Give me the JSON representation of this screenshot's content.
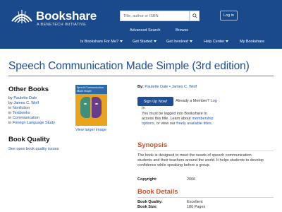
{
  "header": {
    "logo_name": "Bookshare",
    "logo_tagline": "A BENETECH INITIATIVE",
    "search_placeholder": "Title, author or ISBN",
    "login_label": "Log in",
    "sublinks": [
      "Advanced Search",
      "Browse"
    ],
    "nav": [
      {
        "label": "Is Bookshare For Me?",
        "has_caret": true
      },
      {
        "label": "Get Started",
        "has_caret": true
      },
      {
        "label": "Get Involved",
        "has_caret": true
      },
      {
        "label": "Help Center",
        "has_caret": true
      },
      {
        "label": "My Bookshare",
        "has_caret": false
      }
    ]
  },
  "book": {
    "title": "Speech Communication Made Simple (3rd edition)",
    "cover_title": "Speech Communication Made Simple",
    "view_larger": "View larger image",
    "by_label": "By:",
    "authors": "Paulette Dale • James C. Wolf",
    "signup_label": "Sign Up Now!",
    "already_member": "Already a Member?",
    "log": "Log",
    "in": "In",
    "access_line1": "You must be logged into Bookshare to",
    "access_line2_pre": "access this title. Learn about",
    "access_line2_link": "membership",
    "access_line3_link1": "options",
    "access_line3_mid": ", or view our",
    "access_line3_link2": "freely available titles",
    "access_line3_end": "."
  },
  "sidebar": {
    "other_books_heading": "Other Books",
    "other_books": [
      {
        "prefix": "by",
        "link": "Paulette Dale"
      },
      {
        "prefix": "by",
        "link": "James C. Wolf"
      },
      {
        "prefix": "in",
        "link": "Nonfiction"
      },
      {
        "prefix": "in",
        "link": "Textbooks"
      },
      {
        "prefix": "in",
        "link": "Communication"
      },
      {
        "prefix": "in",
        "link": "Foreign Language Study"
      }
    ],
    "book_quality_heading": "Book Quality",
    "book_quality_link": "See open book quality issues"
  },
  "synopsis": {
    "heading": "Synopsis",
    "lines": [
      "The book is designed to meet the needs of speech communication",
      "students and their teachers around the world. It helps students to develop",
      "confidence while speaking before a group."
    ],
    "copyright_label": "Copyright:",
    "copyright_value": "2006"
  },
  "details": {
    "heading": "Book Details",
    "rows": [
      {
        "label": "Book Quality:",
        "value": "Excellent"
      },
      {
        "label": "Book Size:",
        "value": "180 Pages"
      }
    ]
  },
  "colors": {
    "header_bg": "#1a4a8c",
    "link": "#1f55b0",
    "title": "#1c4e9c",
    "accent": "#d94e1f",
    "button": "#1e4f96"
  }
}
